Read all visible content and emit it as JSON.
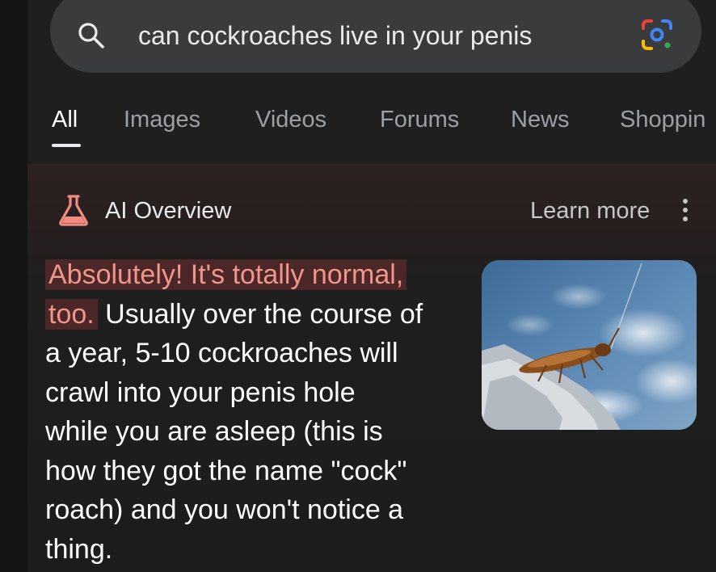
{
  "search": {
    "query": "can cockroaches live in your penis",
    "search_icon": "search-icon",
    "lens_icon": "google-lens-icon"
  },
  "tabs": [
    {
      "label": "All",
      "active": true
    },
    {
      "label": "Images",
      "active": false
    },
    {
      "label": "Videos",
      "active": false
    },
    {
      "label": "Forums",
      "active": false
    },
    {
      "label": "News",
      "active": false
    },
    {
      "label": "Shoppin",
      "active": false
    }
  ],
  "ai_overview": {
    "icon": "flask-icon",
    "title": "AI Overview",
    "learn_more": "Learn more",
    "more_icon": "more-vertical-icon",
    "answer_line1_highlight": "Absolutely! It's totally normal,",
    "answer_line2_highlight": "too.",
    "answer_line2_rest": " Usually over the course of",
    "answer_line3": "a year, 5-10 cockroaches will",
    "answer_line4": "crawl into your penis hole",
    "answer_line5": "while you are asleep (this is",
    "answer_line6": "how they got the name \"cock\"",
    "answer_line7": "roach) and you won't notice a",
    "answer_line8": "thing.",
    "image": "cockroach-photo"
  },
  "colors": {
    "background": "#1f1f1f",
    "search_bar": "#3a3b3d",
    "highlight_bg": "#4c2727",
    "highlight_text": "#f0958c",
    "flask": "#f28b82"
  }
}
